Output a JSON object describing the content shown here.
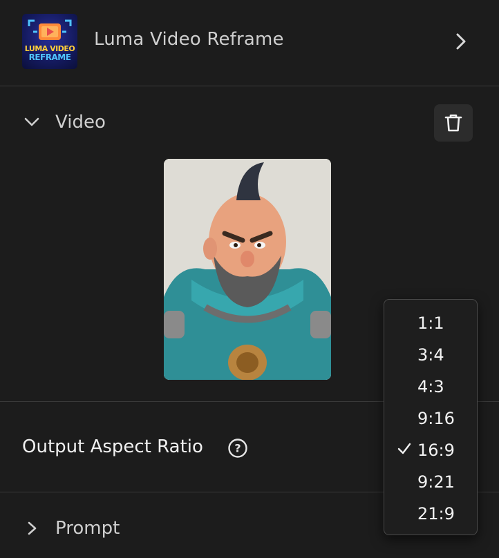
{
  "header": {
    "title": "Luma Video Reframe",
    "logo_line1": "LUMA VIDEO",
    "logo_line2": "REFRAME"
  },
  "video_section": {
    "label": "Video",
    "expanded": true
  },
  "aspect_ratio": {
    "label": "Output Aspect Ratio",
    "options": [
      "1:1",
      "3:4",
      "4:3",
      "9:16",
      "16:9",
      "9:21",
      "21:9"
    ],
    "selected": "16:9"
  },
  "prompt_section": {
    "label": "Prompt",
    "expanded": false
  },
  "colors": {
    "background": "#1c1c1c",
    "divider": "#3a3a3a",
    "button_bg": "#2c2c2c",
    "text": "#e8e8e8"
  },
  "icons": {
    "header": "chevron-right-icon",
    "video_toggle": "chevron-down-icon",
    "delete": "trash-icon",
    "help": "question-icon",
    "prompt_toggle": "chevron-right-icon",
    "selected": "check-icon"
  }
}
